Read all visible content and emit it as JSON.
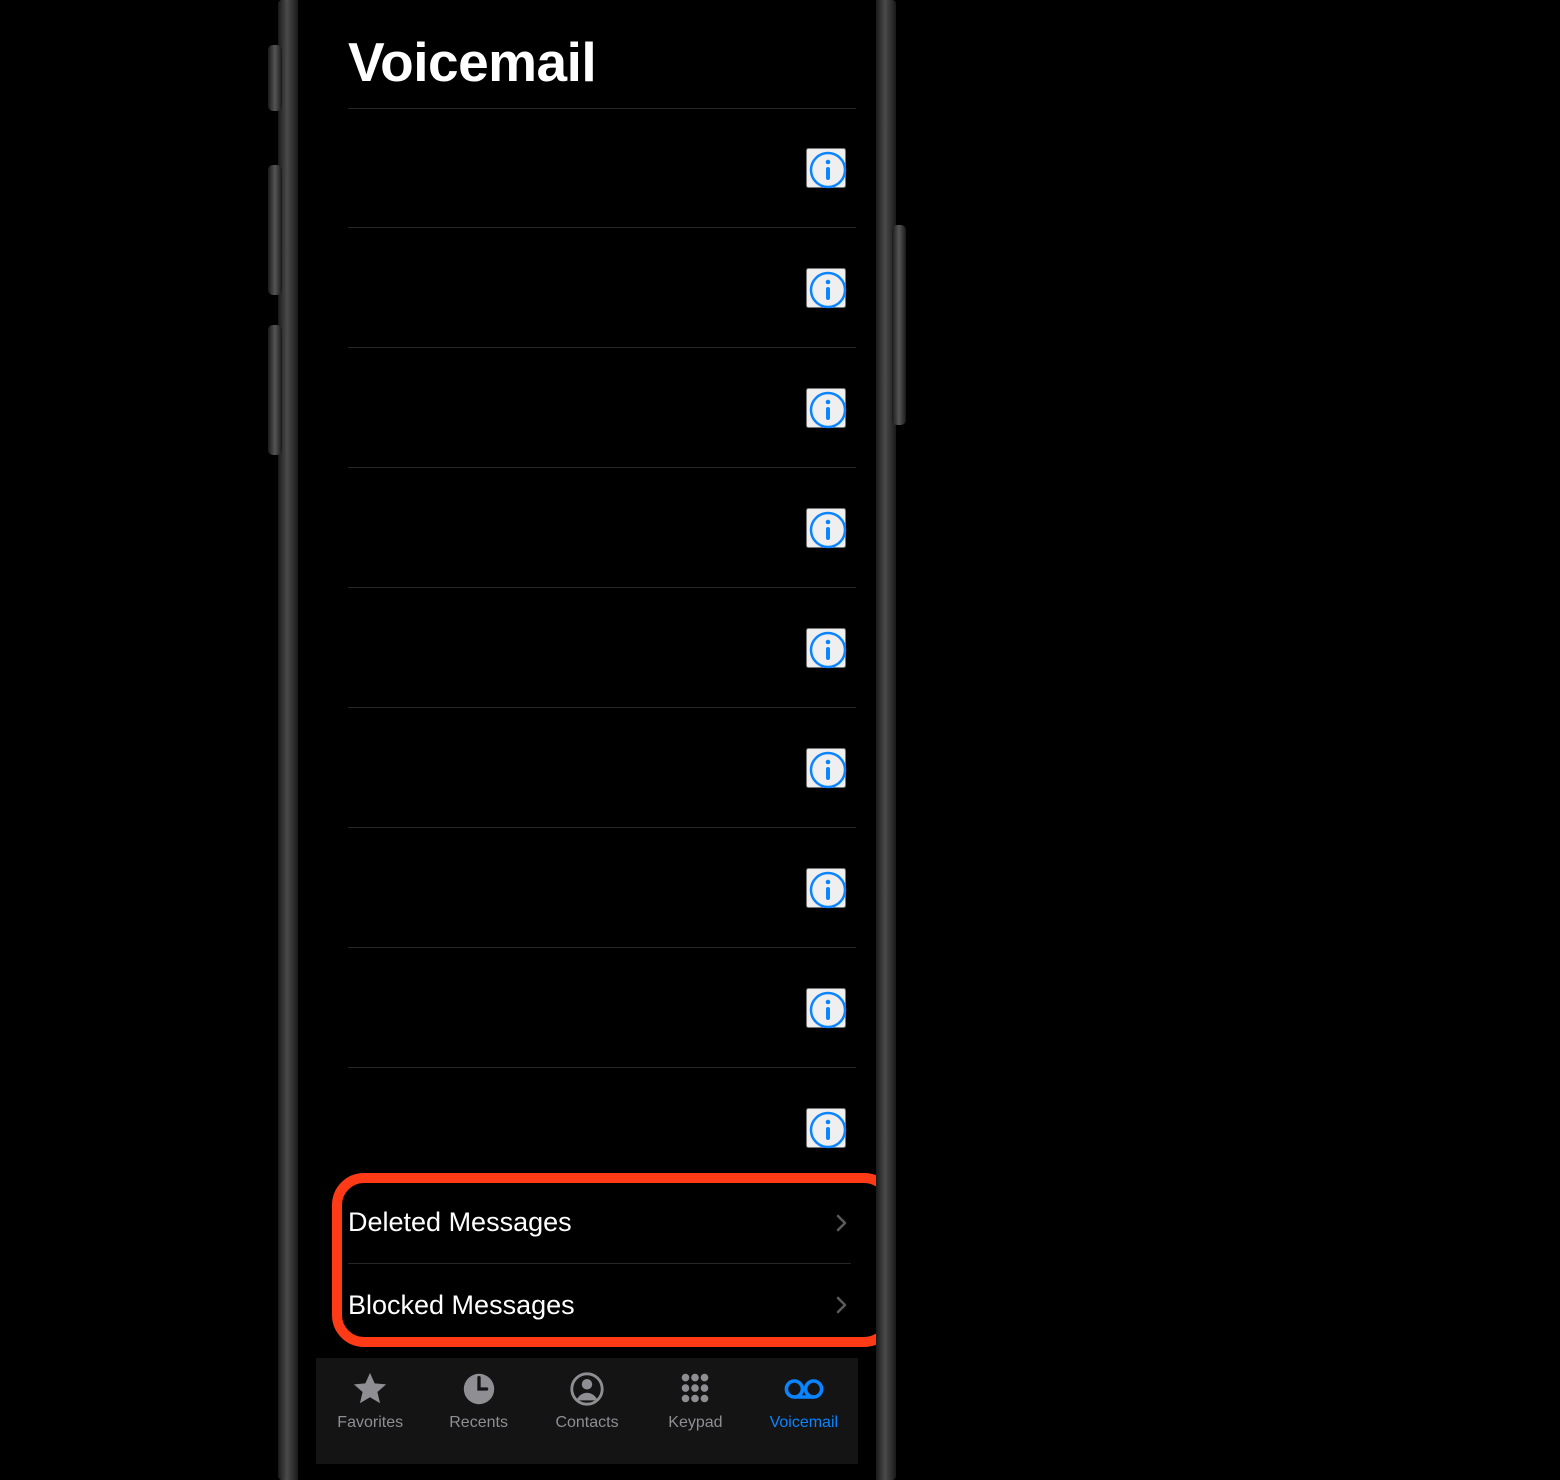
{
  "title": "Voicemail",
  "accent": "#0a84ff",
  "voicemails": [
    {
      "info_icon": "info-icon"
    },
    {
      "info_icon": "info-icon"
    },
    {
      "info_icon": "info-icon"
    },
    {
      "info_icon": "info-icon"
    },
    {
      "info_icon": "info-icon"
    },
    {
      "info_icon": "info-icon"
    },
    {
      "info_icon": "info-icon"
    },
    {
      "info_icon": "info-icon"
    },
    {
      "info_icon": "info-icon"
    }
  ],
  "system_rows": {
    "deleted": "Deleted Messages",
    "blocked": "Blocked Messages"
  },
  "tabs": {
    "favorites": "Favorites",
    "recents": "Recents",
    "contacts": "Contacts",
    "keypad": "Keypad",
    "voicemail": "Voicemail"
  },
  "active_tab": "voicemail"
}
